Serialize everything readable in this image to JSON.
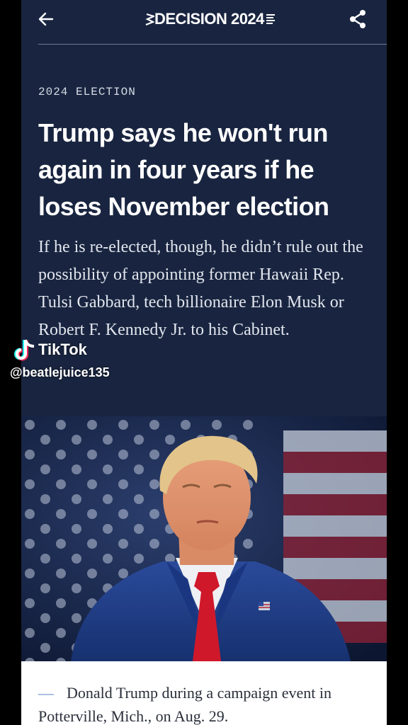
{
  "header": {
    "back_icon": "arrow-left-icon",
    "logo_text": "DECISION 2024",
    "share_icon": "share-icon"
  },
  "article": {
    "kicker": "2024 ELECTION",
    "headline": "Trump says he won't run again in four years if he loses November election",
    "dek": "If he is re-elected, though, he didn’t rule out the possibility of appointing former Hawaii Rep. Tulsi Gabbard, tech billionaire Elon Musk or Robert F. Kennedy Jr. to his Cabinet."
  },
  "photo": {
    "subject": "portrait-photo"
  },
  "caption": {
    "text": "Donald Trump during a campaign event in Potterville, Mich., on Aug. 29."
  },
  "overlay": {
    "brand": "TikTok",
    "username": "@beatlejuice135"
  },
  "colors": {
    "article_bg": "#192540",
    "tie_red": "#d0182b",
    "suit_blue": "#1f3c86",
    "caption_dash": "#6b8fcc"
  }
}
